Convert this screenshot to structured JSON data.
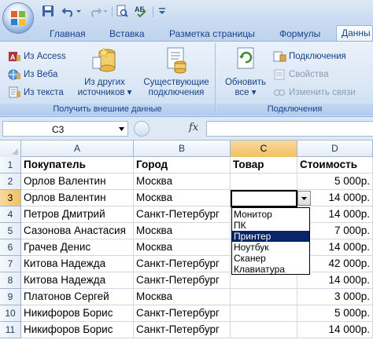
{
  "tabs": [
    "Главная",
    "Вставка",
    "Разметка страницы",
    "Формулы",
    "Данны"
  ],
  "active_tab": "Данны",
  "ribbon": {
    "get_external": {
      "from_access": "Из Access",
      "from_web": "Из Веба",
      "from_text": "Из текста",
      "other_sources_line1": "Из других",
      "other_sources_line2": "источников",
      "existing_line1": "Существующие",
      "existing_line2": "подключения",
      "label": "Получить внешние данные"
    },
    "connections": {
      "refresh_line1": "Обновить",
      "refresh_line2": "все",
      "connections": "Подключения",
      "properties": "Свойства",
      "edit_links": "Изменить связи",
      "label": "Подключения"
    }
  },
  "formula_bar": {
    "name_box": "C3",
    "fx": "fx",
    "value": ""
  },
  "columns": [
    "A",
    "B",
    "C",
    "D"
  ],
  "selected_column": "C",
  "selected_row": 3,
  "rows": [
    {
      "n": "1",
      "a": "Покупатель",
      "b": "Город",
      "c": "Товар",
      "d": "Стоимость"
    },
    {
      "n": "2",
      "a": "Орлов Валентин",
      "b": "Москва",
      "c": "",
      "d": "5 000р."
    },
    {
      "n": "3",
      "a": "Орлов Валентин",
      "b": "Москва",
      "c": "",
      "d": "14 000р."
    },
    {
      "n": "4",
      "a": "Петров Дмитрий",
      "b": "Санкт-Петербург",
      "c": "",
      "d": "14 000р."
    },
    {
      "n": "5",
      "a": "Сазонова Анастасия",
      "b": "Москва",
      "c": "",
      "d": "7 000р."
    },
    {
      "n": "6",
      "a": "Грачев Денис",
      "b": "Москва",
      "c": "",
      "d": "14 000р."
    },
    {
      "n": "7",
      "a": "Китова Надежда",
      "b": "Санкт-Петербург",
      "c": "",
      "d": "42 000р."
    },
    {
      "n": "8",
      "a": "Китова Надежда",
      "b": "Санкт-Петербург",
      "c": "",
      "d": "14 000р."
    },
    {
      "n": "9",
      "a": "Платонов Сергей",
      "b": "Москва",
      "c": "",
      "d": "3 000р."
    },
    {
      "n": "10",
      "a": "Никифоров Борис",
      "b": "Санкт-Петербург",
      "c": "",
      "d": "5 000р."
    },
    {
      "n": "11",
      "a": "Никифоров Борис",
      "b": "Санкт-Петербург",
      "c": "",
      "d": "14 000р."
    }
  ],
  "dropdown": {
    "options": [
      "Монитор",
      "ПК",
      "Принтер",
      "Ноутбук",
      "Сканер",
      "Клавиатура"
    ],
    "selected": "Принтер"
  },
  "colors": {
    "accent": "#15428b",
    "selection_header": "#f1c15f",
    "list_highlight": "#0a246a"
  }
}
